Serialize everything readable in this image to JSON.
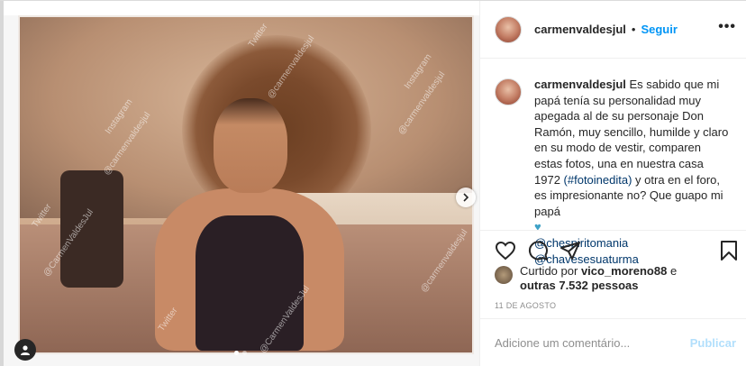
{
  "post": {
    "username": "carmenvaldesjul",
    "separator": "•",
    "follow_label": "Seguir",
    "more_label": "•••",
    "caption_text": "Es sabido que mi papá tenía su personalidad muy apegada al de su personaje Don Ramón, muy sencillo, humilde y claro en su modo de vestir, comparen estas fotos, una en nuestra casa 1972 ",
    "caption_hashtag": "(#fotoinedita)",
    "caption_text_2": " y otra en el foro, es impresionante no? Que guapo mi papá ",
    "caption_emoji": "♥",
    "mention_1": "@chespiritomania",
    "mention_2": "@chavesesuaturma",
    "liked_prefix": "Curtido por",
    "liked_user": "vico_moreno88",
    "liked_mid": "e",
    "liked_others": "outras 7.532 pessoas",
    "date": "11 DE AGOSTO",
    "comment_placeholder": "Adicione um comentário...",
    "publish_label": "Publicar"
  },
  "watermarks": {
    "instagram_line": "Instagram",
    "instagram_handle": "@carmenvaldesjul",
    "twitter_line": "Twitter",
    "twitter_handle": "@CarmenValdesJul"
  },
  "carousel": {
    "total_slides": 2,
    "active_slide": 1
  },
  "colors": {
    "follow": "#0095f6",
    "publish_disabled": "#b2dffc",
    "muted": "#8e8e8e",
    "heart": "#3ea1c6"
  }
}
